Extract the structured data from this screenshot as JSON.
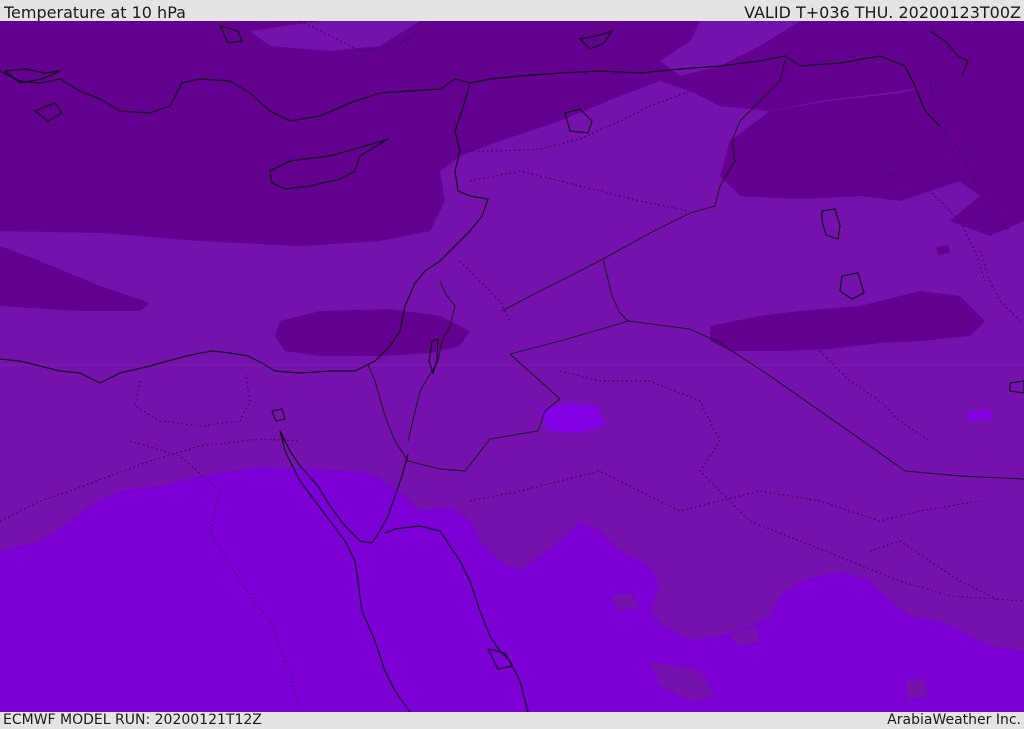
{
  "header": {
    "title": "Temperature at 10 hPa",
    "valid": "VALID T+036 THU. 20200123T00Z"
  },
  "footer": {
    "model_run": "ECMWF MODEL RUN: 20200121T12Z",
    "credit": "ArabiaWeather Inc."
  },
  "map": {
    "region": "Eastern Mediterranean / Middle East",
    "colors": {
      "band_dark": "#63008f",
      "band_mid": "#7511ad",
      "band_light": "#7c00d6",
      "band_lightest": "#8400e6",
      "coastline": "#000000",
      "border": "#111111"
    }
  }
}
